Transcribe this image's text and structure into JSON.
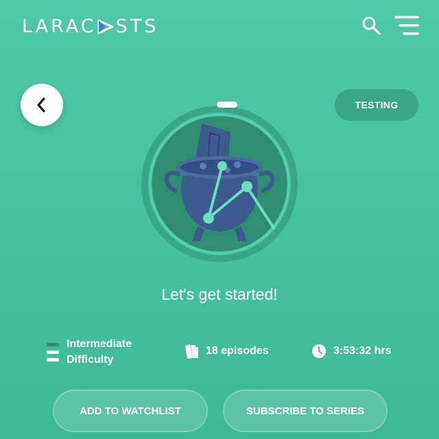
{
  "colors": {
    "background": "#4fc8a8",
    "accent": "#3aa686",
    "logo_accent": "#3a7bd5",
    "hero_dark": "#2f8e71",
    "cauldron": "#3e5b8f",
    "progress_marker": "#ffffff"
  },
  "header": {
    "logo_left": "LARAC",
    "logo_right": "STS",
    "logo_icon": "paper-plane-icon",
    "search_icon": "search-icon",
    "menu_icon": "hamburger-menu-icon"
  },
  "nav": {
    "back_icon": "chevron-left-icon",
    "tag_label": "TESTING"
  },
  "hero": {
    "illustration": "cauldron-icon"
  },
  "tagline": "Let's get started!",
  "stats": {
    "difficulty_line1": "Intermediate",
    "difficulty_line2": "Difficulty",
    "difficulty_icon": "difficulty-level-icon",
    "episodes": "18 episodes",
    "episodes_icon": "books-icon",
    "duration": "3:53:32 hrs",
    "duration_icon": "clock-icon"
  },
  "actions": {
    "watchlist": "ADD TO WATCHLIST",
    "subscribe": "SUBSCRIBE TO SERIES"
  }
}
